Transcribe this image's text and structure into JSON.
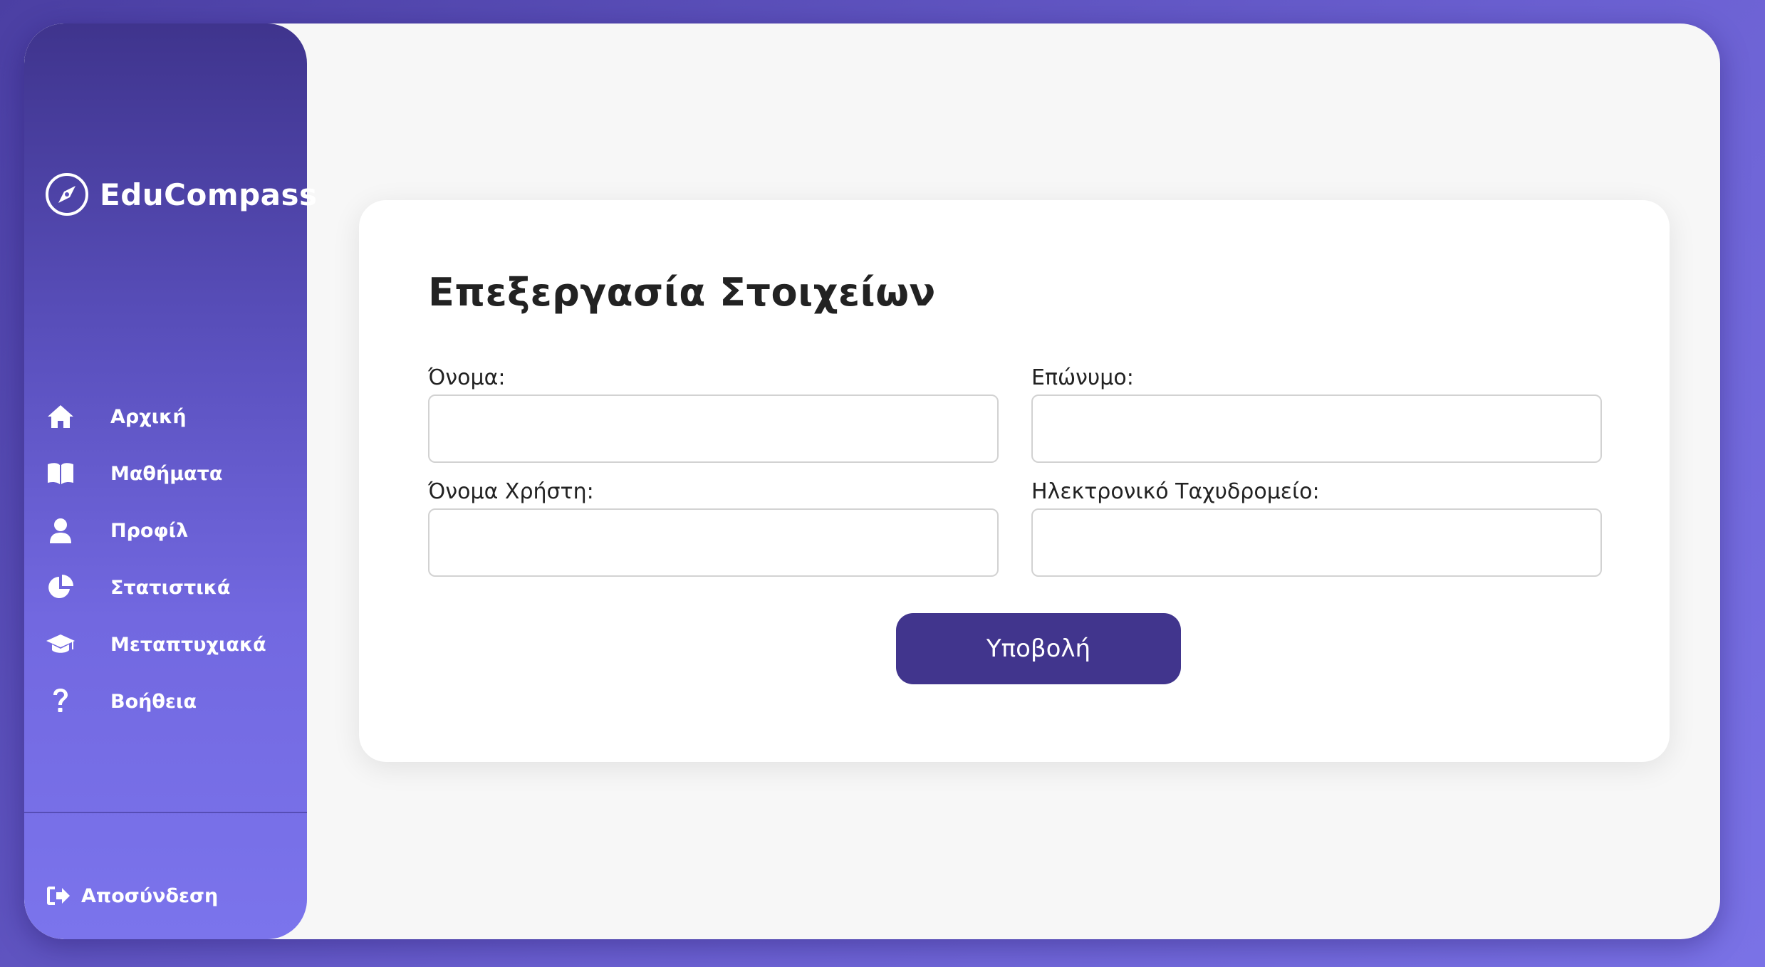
{
  "brand": {
    "name": "EduCompass",
    "icon": "compass-icon"
  },
  "sidebar": {
    "items": [
      {
        "label": "Αρχική",
        "icon": "home-icon"
      },
      {
        "label": "Μαθήματα",
        "icon": "book-icon"
      },
      {
        "label": "Προφίλ",
        "icon": "user-icon"
      },
      {
        "label": "Στατιστικά",
        "icon": "pie-chart-icon"
      },
      {
        "label": "Μεταπτυχιακά",
        "icon": "graduation-cap-icon"
      },
      {
        "label": "Βοήθεια",
        "icon": "question-icon"
      }
    ],
    "logout": {
      "label": "Αποσύνδεση",
      "icon": "sign-out-icon"
    }
  },
  "form": {
    "title": "Επεξεργασία Στοιχείων",
    "fields": [
      {
        "label": "Όνομα:",
        "value": ""
      },
      {
        "label": "Επώνυμο:",
        "value": ""
      },
      {
        "label": "Όνομα Χρήστη:",
        "value": ""
      },
      {
        "label": "Ηλεκτρονικό Ταχυδρομείο:",
        "value": ""
      }
    ],
    "submit_label": "Υποβολή"
  },
  "colors": {
    "sidebar_top": "#3f348d",
    "sidebar_bottom": "#7b74ec",
    "accent_button": "#41358d",
    "content_bg": "#f7f7f7",
    "card_bg": "#ffffff"
  }
}
